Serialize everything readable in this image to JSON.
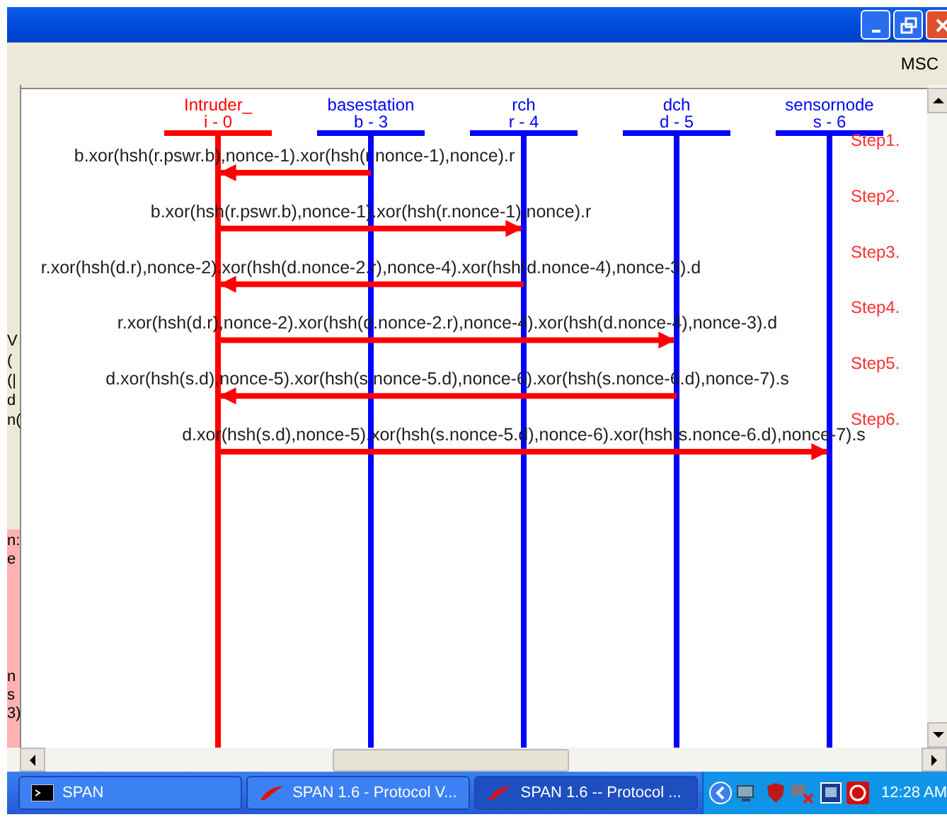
{
  "toolbar": {
    "label": "MSC"
  },
  "left_panel_fragments": {
    "upper": [
      "V",
      "(",
      "(|",
      "d",
      "n("
    ],
    "lower": [
      "n:",
      "e",
      "n",
      "s",
      "3)"
    ]
  },
  "participants": [
    {
      "name": "Intruder_",
      "id": "i - 0",
      "color": "#ff0000"
    },
    {
      "name": "basestation",
      "id": "b - 3",
      "color": "#0000ff",
      "messages": [
        {
          "kind": "incoming",
          "label": "b.xor(hsh(r.pswr.b),nonce-1).xor(hsh(r.nonce-1),nonce).r",
          "step": "Step1."
        }
      ]
    },
    {
      "name": "rch",
      "id": "r - 4",
      "color": "#0000ff",
      "messages": [
        {
          "kind": "outgoing",
          "label": "b.xor(hsh(r.pswr.b),nonce-1).xor(hsh(r.nonce-1),nonce).r",
          "step": "Step2."
        },
        {
          "kind": "incoming",
          "label": "r.xor(hsh(d.r),nonce-2).xor(hsh(d.nonce-2.r),nonce-4).xor(hsh(d.nonce-4),nonce-3).d",
          "step": "Step3."
        }
      ]
    },
    {
      "name": "dch",
      "id": "d - 5",
      "color": "#0000ff",
      "messages": [
        {
          "kind": "outgoing",
          "label": "r.xor(hsh(d.r),nonce-2).xor(hsh(d.nonce-2.r),nonce-4).xor(hsh(d.nonce-4),nonce-3).d",
          "step": "Step4."
        },
        {
          "kind": "incoming",
          "label": "d.xor(hsh(s.d),nonce-5).xor(hsh(s.nonce-5.d),nonce-6).xor(hsh(s.nonce-6.d),nonce-7).s",
          "step": "Step5."
        }
      ]
    },
    {
      "name": "sensornode",
      "id": "s - 6",
      "color": "#0000ff",
      "messages": [
        {
          "kind": "outgoing",
          "label": "d.xor(hsh(s.d),nonce-5).xor(hsh(s.nonce-5.d),nonce-6).xor(hsh(s.nonce-6.d),nonce-7).s",
          "step": "Step6."
        }
      ]
    }
  ],
  "taskbar": {
    "items": [
      {
        "label": "SPAN",
        "kind": "console",
        "selected": false
      },
      {
        "label": "SPAN 1.6 - Protocol V...",
        "kind": "tk",
        "selected": false
      },
      {
        "label": "SPAN 1.6 -- Protocol ...",
        "kind": "tk",
        "selected": true
      }
    ],
    "clock": "12:28 AM"
  }
}
